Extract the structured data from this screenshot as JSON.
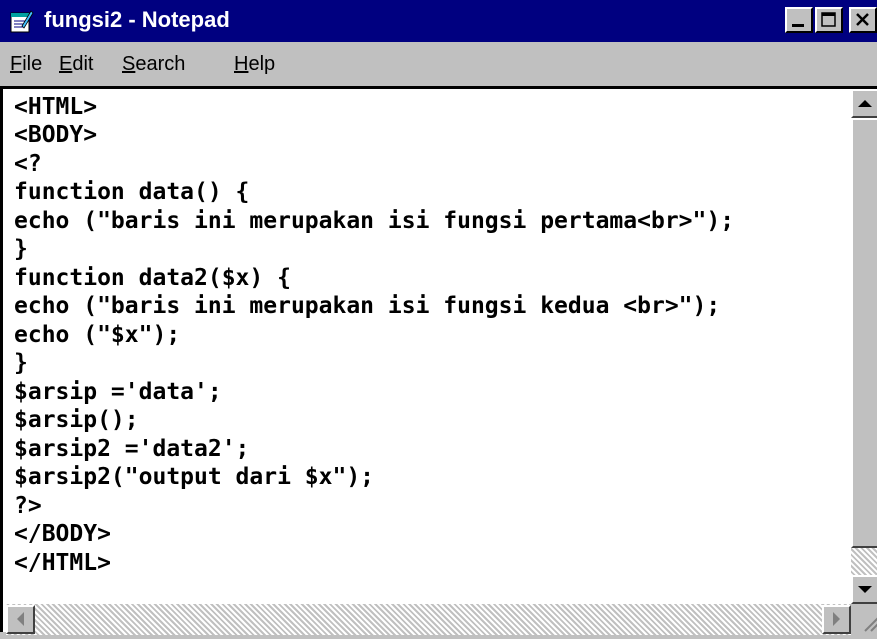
{
  "window": {
    "title": "fungsi2 - Notepad",
    "title_bar_color": "#000080",
    "app_icon": "notepad-icon",
    "controls": {
      "minimize_icon": "minimize-icon",
      "maximize_icon": "maximize-icon",
      "close_icon": "close-icon"
    }
  },
  "menu": {
    "items": [
      {
        "label": "File"
      },
      {
        "label": "Edit"
      },
      {
        "label": "Search"
      },
      {
        "label": "Help"
      }
    ]
  },
  "editor": {
    "lines": [
      "<HTML>",
      "<BODY>",
      "<?",
      "function data() {",
      "echo (\"baris ini merupakan isi fungsi pertama<br>\");",
      "}",
      "function data2($x) {",
      "echo (\"baris ini merupakan isi fungsi kedua <br>\");",
      "echo (\"$x\");",
      "}",
      "$arsip ='data';",
      "$arsip();",
      "$arsip2 ='data2';",
      "$arsip2(\"output dari $x\");",
      "?>",
      "</BODY>",
      "</HTML>"
    ]
  },
  "scrollbars": {
    "vertical": {
      "up_icon": "scroll-up-arrow-icon",
      "down_icon": "scroll-down-arrow-icon"
    },
    "horizontal": {
      "left_icon": "scroll-left-arrow-icon",
      "right_icon": "scroll-right-arrow-icon"
    }
  }
}
